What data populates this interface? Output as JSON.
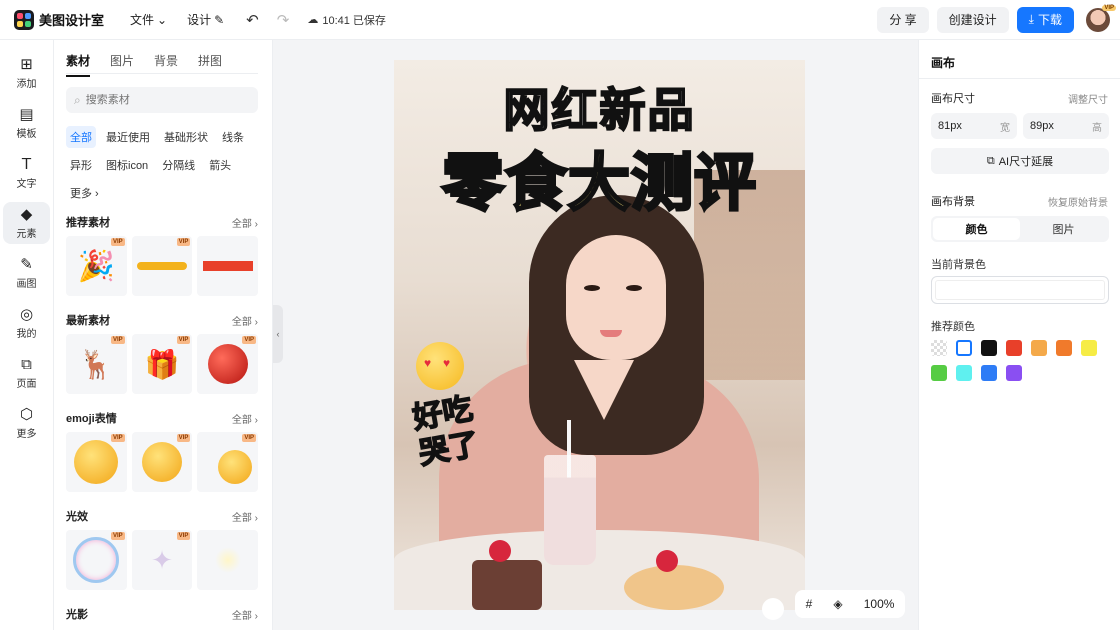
{
  "app": {
    "name": "美图设计室",
    "logo_colors": [
      "#ff4d6d",
      "#4d9bff",
      "#ffd54d",
      "#43d17a"
    ]
  },
  "topbar": {
    "menu": [
      {
        "label": "文件",
        "icon": "chevron-down-icon"
      },
      {
        "label": "设计",
        "icon": "edit-icon"
      }
    ],
    "undo_icon": "undo-icon",
    "redo_icon": "redo-icon",
    "saved_status": "10:41 已保存",
    "share_label": "分 享",
    "create_label": "创建设计",
    "download_label": "下载",
    "avatar_badge": "VIP"
  },
  "rail": {
    "items": [
      {
        "label": "添加",
        "icon": "plus-square-icon"
      },
      {
        "label": "模板",
        "icon": "template-icon"
      },
      {
        "label": "文字",
        "icon": "text-icon"
      },
      {
        "label": "元素",
        "icon": "shapes-icon",
        "active": true
      },
      {
        "label": "画图",
        "icon": "pencil-icon"
      },
      {
        "label": "我的",
        "icon": "user-icon"
      },
      {
        "label": "页面",
        "icon": "page-add-icon"
      },
      {
        "label": "更多",
        "icon": "cube-icon"
      }
    ]
  },
  "panel": {
    "tabs": [
      "素材",
      "图片",
      "背景",
      "拼图"
    ],
    "active_tab": "素材",
    "search_placeholder": "搜索素材",
    "chips": [
      "全部",
      "最近使用",
      "基础形状",
      "线条",
      "异形",
      "图标icon",
      "分隔线",
      "箭头",
      "更多"
    ],
    "active_chip": "全部",
    "sections": [
      {
        "title": "推荐素材",
        "all_label": "全部",
        "thumbs": [
          {
            "vip": "VIP",
            "kind": "party-popper"
          },
          {
            "vip": "VIP",
            "kind": "yellow-brush-stroke"
          },
          {
            "vip": "",
            "kind": "red-bar"
          }
        ]
      },
      {
        "title": "最新素材",
        "all_label": "全部",
        "thumbs": [
          {
            "vip": "VIP",
            "kind": "reindeer-sleigh"
          },
          {
            "vip": "VIP",
            "kind": "gift-snowglobe"
          },
          {
            "vip": "VIP",
            "kind": "red-apple"
          }
        ]
      },
      {
        "title": "emoji表情",
        "all_label": "全部",
        "thumbs": [
          {
            "vip": "VIP",
            "kind": "shocked-emoji"
          },
          {
            "vip": "VIP",
            "kind": "thinking-emoji"
          },
          {
            "vip": "VIP",
            "kind": "checklist-emoji"
          }
        ]
      },
      {
        "title": "光效",
        "all_label": "全部",
        "thumbs": [
          {
            "vip": "VIP",
            "kind": "bubble-ring"
          },
          {
            "vip": "VIP",
            "kind": "sparkle-star"
          },
          {
            "vip": "",
            "kind": "glow-dot"
          }
        ]
      },
      {
        "title": "光影",
        "all_label": "全部",
        "thumbs": []
      }
    ]
  },
  "canvas": {
    "title_line1": "网红新品",
    "title_line2": "零食大测评",
    "side_text_line1": "好吃",
    "side_text_line2": "哭了",
    "zoom": "100%",
    "grid_icon": "grid-icon",
    "layers_icon": "layers-icon"
  },
  "props": {
    "title": "画布",
    "size_label": "画布尺寸",
    "size_link": "调整尺寸",
    "width_value": "81px",
    "width_unit": "宽",
    "height_value": "89px",
    "height_unit": "高",
    "ai_button": "AI尺寸延展",
    "bg_label": "画布背景",
    "bg_link": "恢复原始背景",
    "bg_tabs": [
      "颜色",
      "图片"
    ],
    "current_bg_label": "当前背景色",
    "current_bg_color": "#ffffff",
    "recommend_label": "推荐颜色",
    "swatches": [
      "transparent",
      "#ffffff",
      "#111111",
      "#e8402a",
      "#f4a94a",
      "#f07a2b",
      "#f6ec45",
      "#56cc44",
      "#5ff0ef",
      "#2e7cf6",
      "#8a4ff2"
    ]
  }
}
